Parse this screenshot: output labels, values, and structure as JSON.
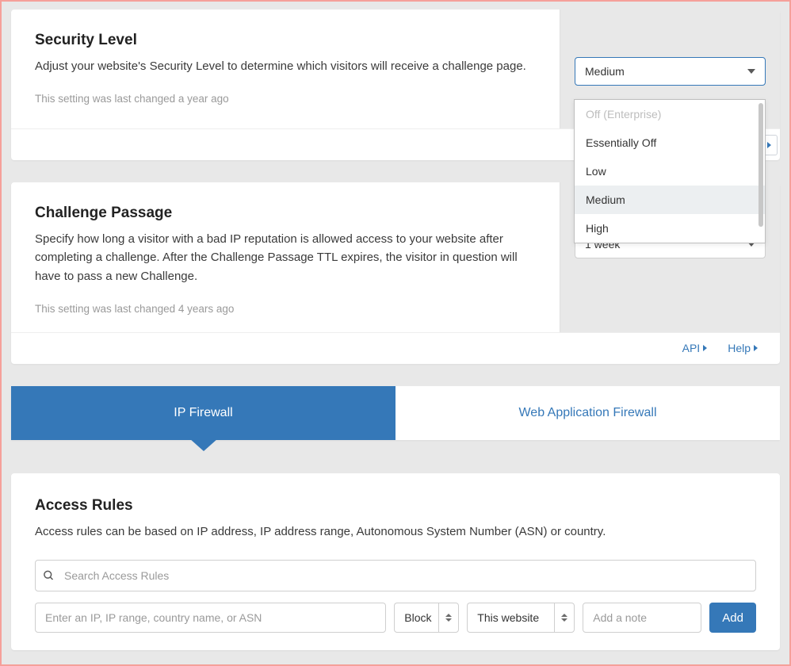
{
  "security_level": {
    "title": "Security Level",
    "desc": "Adjust your website's Security Level to determine which visitors will receive a challenge page.",
    "meta": "This setting was last changed a year ago",
    "selected": "Medium",
    "options": [
      {
        "label": "Off (Enterprise)",
        "disabled": true
      },
      {
        "label": "Essentially Off",
        "disabled": false
      },
      {
        "label": "Low",
        "disabled": false
      },
      {
        "label": "Medium",
        "disabled": false,
        "selected": true
      },
      {
        "label": "High",
        "disabled": false
      }
    ]
  },
  "challenge_passage": {
    "title": "Challenge Passage",
    "desc": "Specify how long a visitor with a bad IP reputation is allowed access to your website after completing a challenge. After the Challenge Passage TTL expires, the visitor in question will have to pass a new Challenge.",
    "meta": "This setting was last changed 4 years ago",
    "selected": "1 week"
  },
  "footer": {
    "api": "API",
    "help": "Help"
  },
  "tabs": {
    "ip_firewall": "IP Firewall",
    "waf": "Web Application Firewall"
  },
  "access_rules": {
    "title": "Access Rules",
    "desc": "Access rules can be based on IP address, IP address range, Autonomous System Number (ASN) or country.",
    "search_placeholder": "Search Access Rules",
    "ip_placeholder": "Enter an IP, IP range, country name, or ASN",
    "action": "Block",
    "scope": "This website",
    "note_placeholder": "Add a note",
    "add_button": "Add"
  }
}
